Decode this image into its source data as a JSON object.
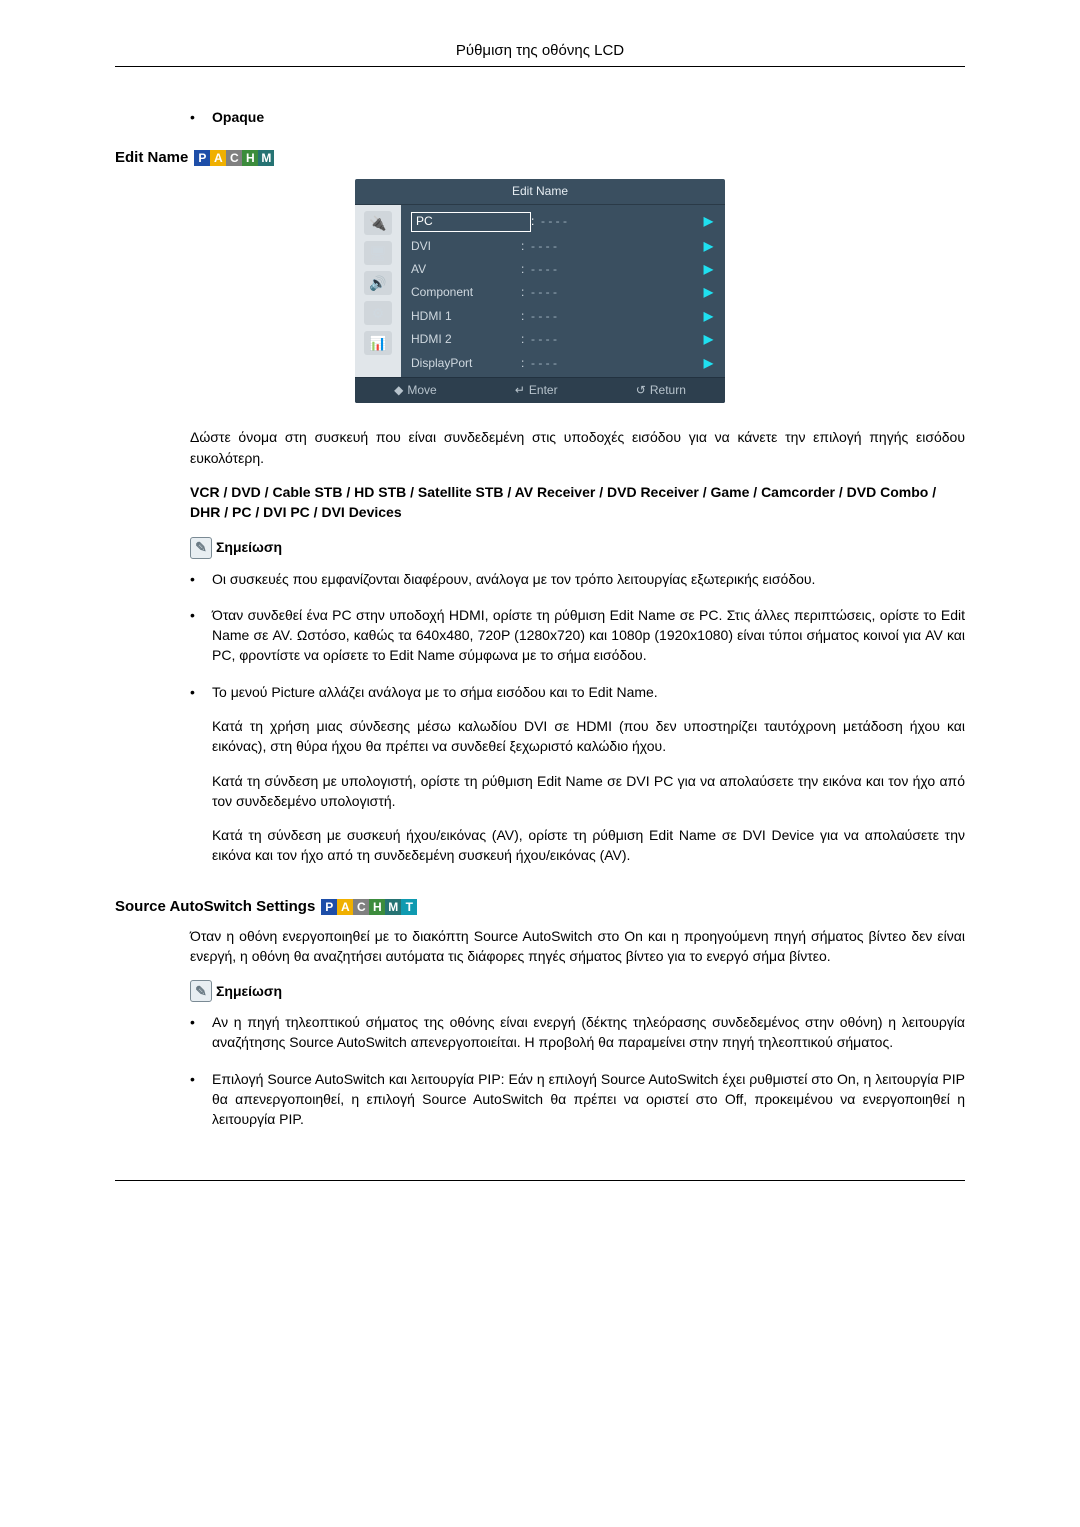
{
  "header": {
    "title": "Ρύθμιση της οθόνης LCD"
  },
  "opaque": {
    "label": "Opaque"
  },
  "section_edit_name": {
    "title": "Edit Name",
    "badges": [
      "P",
      "A",
      "C",
      "H",
      "M"
    ],
    "osd": {
      "title": "Edit Name",
      "rows": [
        {
          "label": "PC",
          "value": "- - - -",
          "selected": true
        },
        {
          "label": "DVI",
          "value": "- - - -"
        },
        {
          "label": "AV",
          "value": "- - - -"
        },
        {
          "label": "Component",
          "value": "- - - -"
        },
        {
          "label": "HDMI 1",
          "value": "- - - -"
        },
        {
          "label": "HDMI 2",
          "value": "- - - -"
        },
        {
          "label": "DisplayPort",
          "value": "- - - -"
        }
      ],
      "footer": {
        "move": "Move",
        "enter": "Enter",
        "return": "Return"
      }
    },
    "intro": "Δώστε όνομα στη συσκευή που είναι συνδεδεμένη στις υποδοχές εισόδου για να κάνετε την επιλογή πηγής εισόδου ευκολότερη.",
    "devices_line": "VCR / DVD / Cable STB / HD STB / Satellite STB / AV Receiver / DVD Receiver / Game / Camcorder / DVD Combo / DHR / PC / DVI PC / DVI Devices",
    "note_label": "Σημείωση",
    "bullets": [
      "Οι συσκευές που εμφανίζονται διαφέρουν, ανάλογα με τον τρόπο λειτουργίας εξωτερικής εισόδου.",
      "Όταν συνδεθεί ένα PC στην υποδοχή HDMI, ορίστε τη ρύθμιση Edit Name σε PC. Στις άλλες περιπτώσεις, ορίστε το Edit Name σε AV. Ωστόσο, καθώς τα 640x480, 720P (1280x720) και 1080p (1920x1080) είναι τύποι σήματος κοινοί για AV και PC, φροντίστε να ορίσετε το Edit Name σύμφωνα με το σήμα εισόδου.",
      "Το μενού Picture αλλάζει ανάλογα με το σήμα εισόδου και το Edit Name."
    ],
    "sub_paragraphs": [
      "Κατά τη χρήση μιας σύνδεσης μέσω καλωδίου DVI σε HDMI (που δεν υποστηρίζει ταυτόχρονη μετάδοση ήχου και εικόνας), στη θύρα ήχου θα πρέπει να συνδεθεί ξεχωριστό καλώδιο ήχου.",
      "Κατά τη σύνδεση με υπολογιστή, ορίστε τη ρύθμιση Edit Name σε DVI PC για να απολαύσετε την εικόνα και τον ήχο από τον συνδεδεμένο υπολογιστή.",
      "Κατά τη σύνδεση με συσκευή ήχου/εικόνας (AV), ορίστε τη ρύθμιση Edit Name σε DVI Device για να απολαύσετε την εικόνα και τον ήχο από τη συνδεδεμένη συσκευή ήχου/εικόνας (AV)."
    ]
  },
  "section_autoswitch": {
    "title": "Source AutoSwitch Settings",
    "badges": [
      "P",
      "A",
      "C",
      "H",
      "M",
      "T"
    ],
    "intro": "Όταν η οθόνη ενεργοποιηθεί με το διακόπτη Source AutoSwitch στο On και η προηγούμενη πηγή σήματος βίντεο δεν είναι ενεργή, η οθόνη θα αναζητήσει αυτόματα τις διάφορες πηγές σήματος βίντεο για το ενεργό σήμα βίντεο.",
    "note_label": "Σημείωση",
    "bullets": [
      "Αν η πηγή τηλεοπτικού σήματος της οθόνης είναι ενεργή (δέκτης τηλεόρασης συνδεδεμένος στην οθόνη) η λειτουργία αναζήτησης Source AutoSwitch απενεργοποιείται. Η προβολή θα παραμείνει στην πηγή τηλεοπτικού σήματος.",
      "Επιλογή Source AutoSwitch και λειτουργία PIP: Εάν η επιλογή Source AutoSwitch έχει ρυθμιστεί στο On, η λειτουργία PIP θα απενεργοποιηθεί, η επιλογή Source AutoSwitch θα πρέπει να οριστεί στο Off, προκειμένου να ενεργοποιηθεί η λειτουργία PIP."
    ]
  }
}
